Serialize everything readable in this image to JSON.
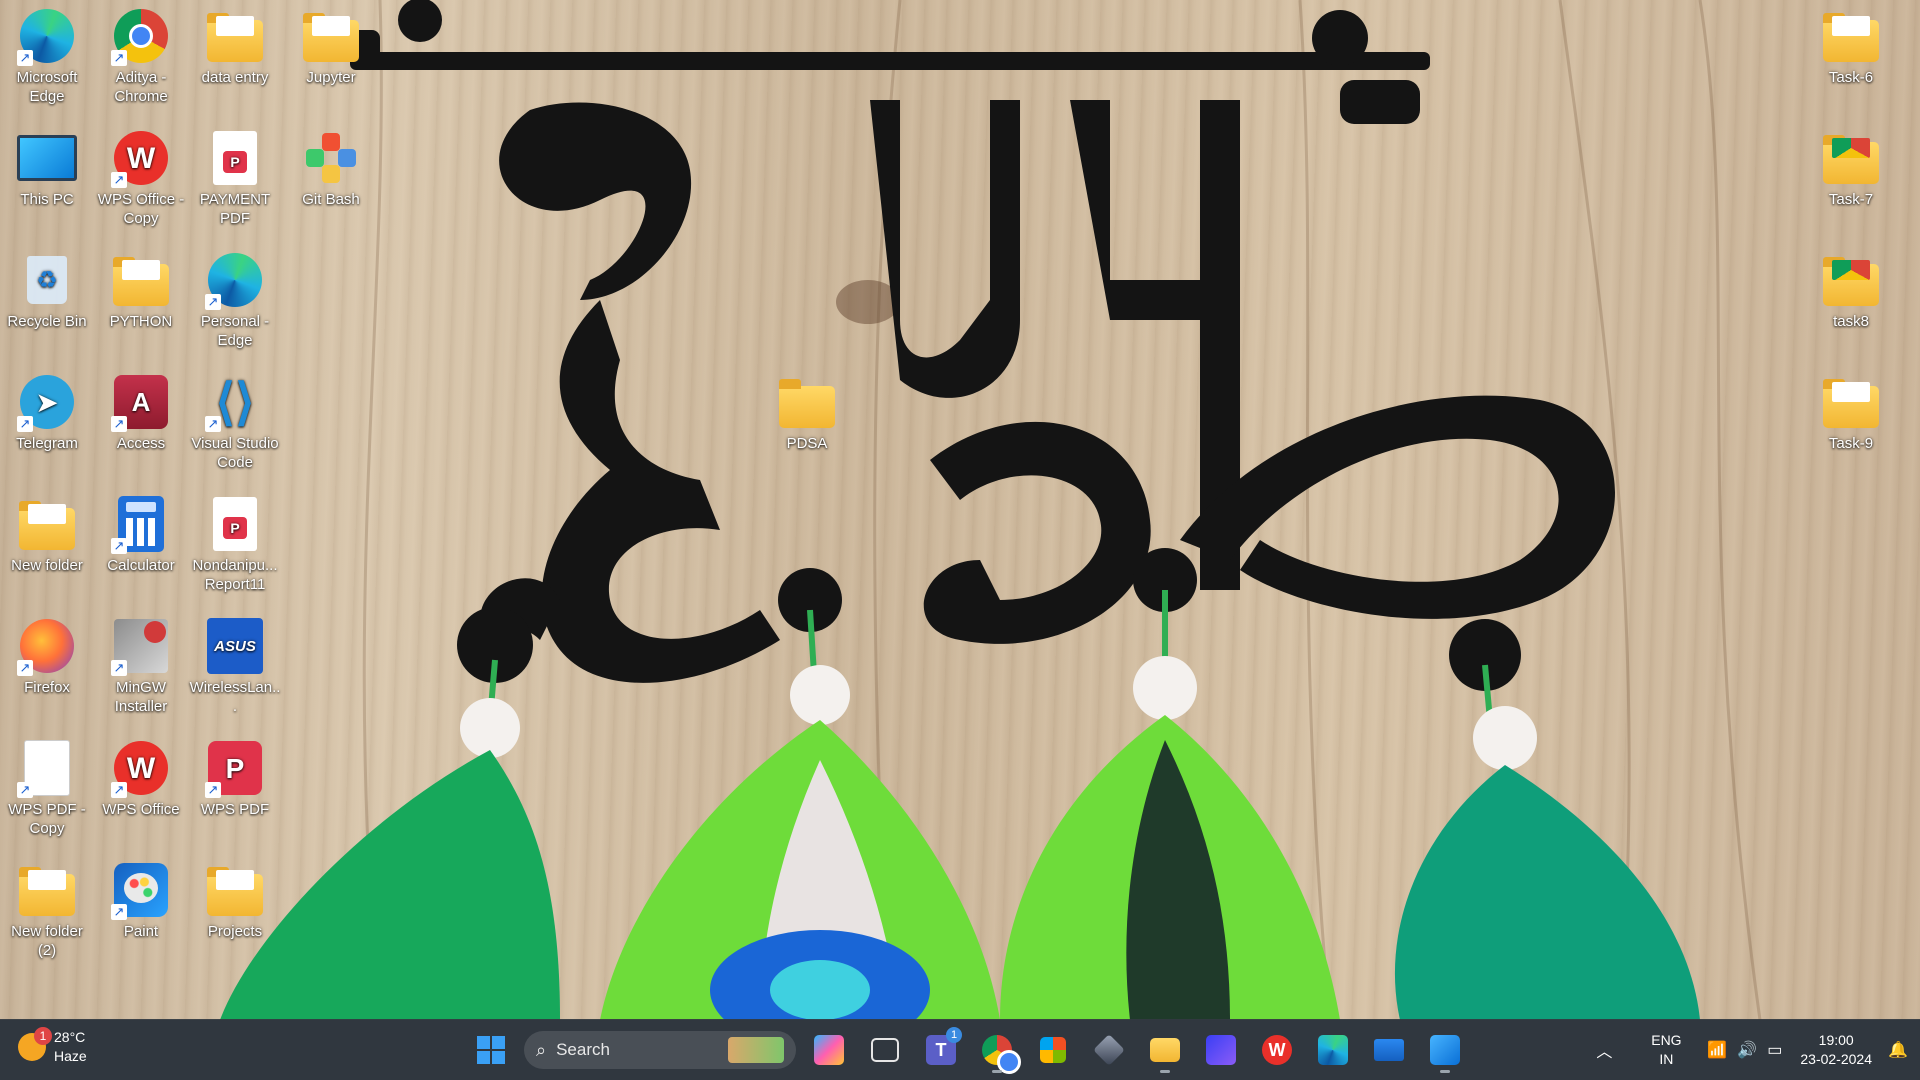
{
  "desktop": {
    "icons": [
      {
        "label": "Microsoft Edge",
        "icon": "edge-icon"
      },
      {
        "label": "Aditya - Chrome",
        "icon": "chrome-icon"
      },
      {
        "label": "data entry",
        "icon": "folder-icon"
      },
      {
        "label": "Jupyter",
        "icon": "folder-icon"
      },
      {
        "label": "This PC",
        "icon": "monitor-icon"
      },
      {
        "label": "WPS Office - Copy",
        "icon": "wps-office-icon"
      },
      {
        "label": "PAYMENT PDF",
        "icon": "pdf-document-icon"
      },
      {
        "label": "Git Bash",
        "icon": "git-bash-icon"
      },
      {
        "label": "Recycle Bin",
        "icon": "recycle-bin-icon"
      },
      {
        "label": "PYTHON",
        "icon": "folder-icon"
      },
      {
        "label": "Personal - Edge",
        "icon": "edge-icon"
      },
      {
        "label": "Telegram",
        "icon": "telegram-icon"
      },
      {
        "label": "Access",
        "icon": "access-icon"
      },
      {
        "label": "Visual Studio Code",
        "icon": "vscode-icon"
      },
      {
        "label": "New folder",
        "icon": "folder-icon"
      },
      {
        "label": "Calculator",
        "icon": "calculator-icon"
      },
      {
        "label": "Nondanipu... Report11",
        "icon": "pdf-document-icon"
      },
      {
        "label": "Firefox",
        "icon": "firefox-icon"
      },
      {
        "label": "MinGW Installer",
        "icon": "mingw-icon"
      },
      {
        "label": "WirelessLan...",
        "icon": "asus-icon"
      },
      {
        "label": "WPS PDF - Copy",
        "icon": "blank-document-icon"
      },
      {
        "label": "WPS Office",
        "icon": "wps-office-icon"
      },
      {
        "label": "WPS PDF",
        "icon": "wps-pdf-icon"
      },
      {
        "label": "New folder (2)",
        "icon": "folder-icon"
      },
      {
        "label": "Paint",
        "icon": "paint-icon"
      },
      {
        "label": "Projects",
        "icon": "folder-icon"
      },
      {
        "label": "PDSA",
        "icon": "folder-icon"
      },
      {
        "label": "Task-6",
        "icon": "folder-icon"
      },
      {
        "label": "Task-7",
        "icon": "folder-icon"
      },
      {
        "label": "task8",
        "icon": "folder-icon"
      },
      {
        "label": "Task-9",
        "icon": "folder-icon"
      }
    ]
  },
  "taskbar": {
    "weather": {
      "temp": "28°C",
      "condition": "Haze",
      "badge": "1"
    },
    "search_placeholder": "Search",
    "teams_badge": "1",
    "pinned": [
      "copilot-icon",
      "task-view-icon",
      "teams-icon",
      "chrome-icon",
      "microsoft-store-icon",
      "app-icon",
      "file-explorer-icon",
      "app-icon",
      "wps-office-icon",
      "edge-icon",
      "mail-icon",
      "photos-icon"
    ],
    "tray": {
      "lang_top": "ENG",
      "lang_bottom": "IN",
      "time": "19:00",
      "date": "23-02-2024"
    }
  },
  "wallpaper": {
    "text": "कृष्णा"
  }
}
